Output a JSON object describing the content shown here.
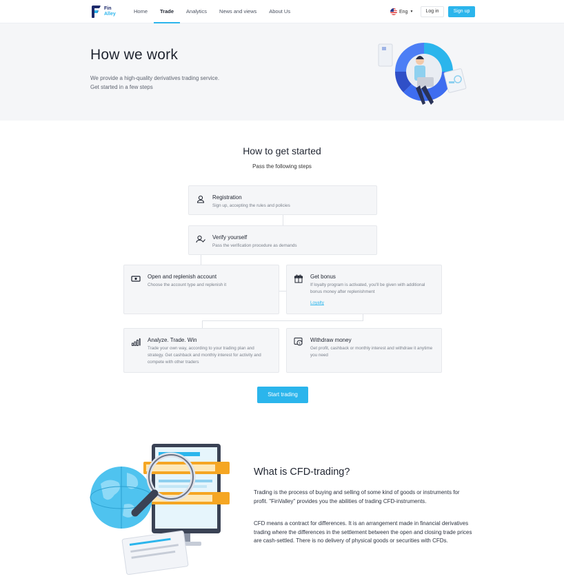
{
  "header": {
    "logo": {
      "line1": "Fin",
      "line2": "Alley"
    },
    "nav": [
      "Home",
      "Trade",
      "Analytics",
      "News and views",
      "About Us"
    ],
    "active_nav": "Trade",
    "language": "Eng",
    "login_label": "Log in",
    "signup_label": "Sign up"
  },
  "hero": {
    "title": "How we work",
    "subtitle_line1": "We provide a high-quality derivatives trading service.",
    "subtitle_line2": "Get started in a few steps"
  },
  "steps": {
    "title": "How to get started",
    "subtitle": "Pass the following steps",
    "items": [
      {
        "title": "Registration",
        "description": "Sign up, accepting the rules and policies",
        "icon": "user-icon"
      },
      {
        "title": "Verify yourself",
        "description": "Pass the verification procedure as demands",
        "icon": "user-check-icon"
      },
      {
        "title": "Open and replenish account",
        "description": "Choose the account type and replenish it",
        "icon": "banknote-icon"
      },
      {
        "title": "Get bonus",
        "description": "If loyalty program is activated, you'll be given with additional bonus money after replenishment",
        "link": "Loyalty",
        "icon": "gift-icon"
      },
      {
        "title": "Analyze. Trade. Win",
        "description": "Trade your own way, according to your trading plan and strategy. Get cashback and monthly interest for activity and compete with other traders",
        "icon": "bar-chart-icon"
      },
      {
        "title": "Withdraw money",
        "description": "Get profit, cashback or monthly interest and withdraw it anytime you need",
        "icon": "withdraw-icon"
      }
    ],
    "cta_label": "Start trading"
  },
  "cfd": {
    "title": "What is CFD-trading?",
    "paragraph1": "Trading is the process of buying and selling of some kind of goods or instruments for profit. \"FinValley\" provides you the abilities of trading CFD-instruments.",
    "paragraph2": "CFD means a contract for differences. It is an arrangement made in financial derivatives trading where the differences in the settlement between the open and closing trade prices are cash-settled. There is no delivery of physical goods or securities with CFDs."
  },
  "colors": {
    "accent": "#2bb5ec",
    "brand_dark": "#1d2a6b",
    "hero_bg": "#f5f6f8"
  }
}
